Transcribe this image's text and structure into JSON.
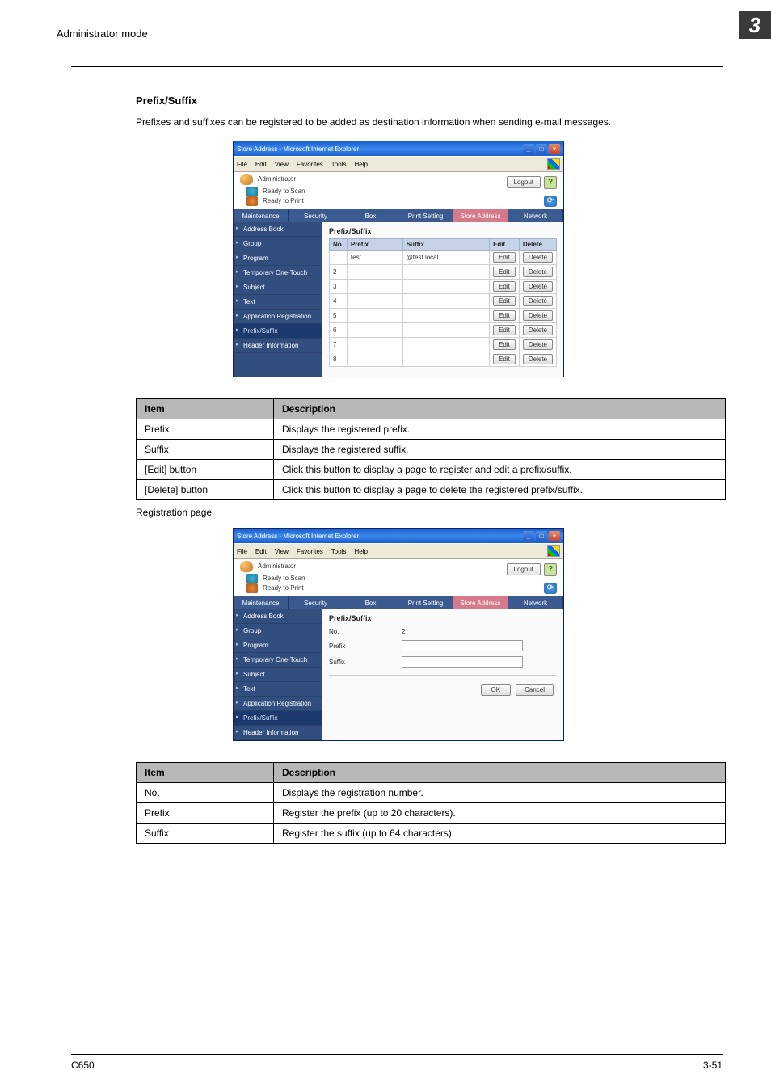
{
  "header": {
    "mode": "Administrator mode",
    "chapter": "3"
  },
  "section": {
    "title": "Prefix/Suffix",
    "intro": "Prefixes and suffixes can be registered to be added as destination information when sending e-mail messages.",
    "regpage_label": "Registration page"
  },
  "ie": {
    "title": "Store Address - Microsoft Internet Explorer",
    "menu": {
      "file": "File",
      "edit": "Edit",
      "view": "View",
      "favorites": "Favorites",
      "tools": "Tools",
      "help": "Help"
    }
  },
  "app": {
    "admin_label": "Administrator",
    "logout": "Logout",
    "ready_scan": "Ready to Scan",
    "ready_print": "Ready to Print",
    "tabs": {
      "maintenance": "Maintenance",
      "security": "Security",
      "box": "Box",
      "print": "Print Setting",
      "store": "Store Address",
      "network": "Network"
    },
    "sidebar": {
      "items": [
        {
          "label": "Address Book"
        },
        {
          "label": "Group"
        },
        {
          "label": "Program"
        },
        {
          "label": "Temporary One-Touch"
        },
        {
          "label": "Subject"
        },
        {
          "label": "Text"
        },
        {
          "label": "Application Registration"
        },
        {
          "label": "Prefix/Suffix"
        },
        {
          "label": "Header Information"
        }
      ]
    },
    "list_screen": {
      "title": "Prefix/Suffix",
      "cols": {
        "no": "No.",
        "prefix": "Prefix",
        "suffix": "Suffix",
        "edit": "Edit",
        "delete": "Delete"
      },
      "edit_btn": "Edit",
      "delete_btn": "Delete",
      "rows": [
        {
          "no": "1",
          "prefix": "test",
          "suffix": "@test.local"
        },
        {
          "no": "2",
          "prefix": "",
          "suffix": ""
        },
        {
          "no": "3",
          "prefix": "",
          "suffix": ""
        },
        {
          "no": "4",
          "prefix": "",
          "suffix": ""
        },
        {
          "no": "5",
          "prefix": "",
          "suffix": ""
        },
        {
          "no": "6",
          "prefix": "",
          "suffix": ""
        },
        {
          "no": "7",
          "prefix": "",
          "suffix": ""
        },
        {
          "no": "8",
          "prefix": "",
          "suffix": ""
        }
      ]
    },
    "form_screen": {
      "title": "Prefix/Suffix",
      "labels": {
        "no": "No.",
        "prefix": "Prefix",
        "suffix": "Suffix"
      },
      "no_value": "2",
      "ok": "OK",
      "cancel": "Cancel"
    }
  },
  "table1": {
    "head": {
      "item": "Item",
      "desc": "Description"
    },
    "rows": [
      {
        "item": "Prefix",
        "desc": "Displays the registered prefix."
      },
      {
        "item": "Suffix",
        "desc": "Displays the registered suffix."
      },
      {
        "item": "[Edit] button",
        "desc": "Click this button to display a page to register and edit a prefix/suffix."
      },
      {
        "item": "[Delete] button",
        "desc": "Click this button to display a page to delete the registered prefix/suffix."
      }
    ]
  },
  "table2": {
    "head": {
      "item": "Item",
      "desc": "Description"
    },
    "rows": [
      {
        "item": "No.",
        "desc": "Displays the registration number."
      },
      {
        "item": "Prefix",
        "desc": "Register the prefix (up to 20 characters)."
      },
      {
        "item": "Suffix",
        "desc": "Register the suffix (up to 64 characters)."
      }
    ]
  },
  "footer": {
    "model": "C650",
    "page": "3-51"
  }
}
